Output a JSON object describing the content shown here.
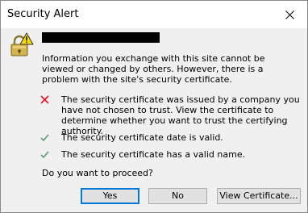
{
  "window": {
    "title": "Security Alert",
    "close_label": "✕"
  },
  "alert": {
    "info_text": "Information you exchange with this site cannot be viewed or changed by others. However, there is a problem with the site's security certificate.",
    "checks": [
      {
        "status": "error",
        "icon": "red-x-icon",
        "color": "#e81123",
        "text": "The security certificate was issued by a company you have not chosen to trust. View the certificate to determine whether you want to trust the certifying authority."
      },
      {
        "status": "ok",
        "icon": "green-check-icon",
        "color": "#5a9e6f",
        "text": "The security certificate date is valid."
      },
      {
        "status": "ok",
        "icon": "green-check-icon",
        "color": "#5a9e6f",
        "text": "The security certificate has a valid name."
      }
    ],
    "question": "Do you want to proceed?"
  },
  "buttons": {
    "yes": "Yes",
    "no": "No",
    "view_certificate": "View Certificate..."
  },
  "colors": {
    "accent": "#0078d7",
    "lock_gold": "#d4b24c",
    "warning_yellow": "#f5d90a"
  }
}
